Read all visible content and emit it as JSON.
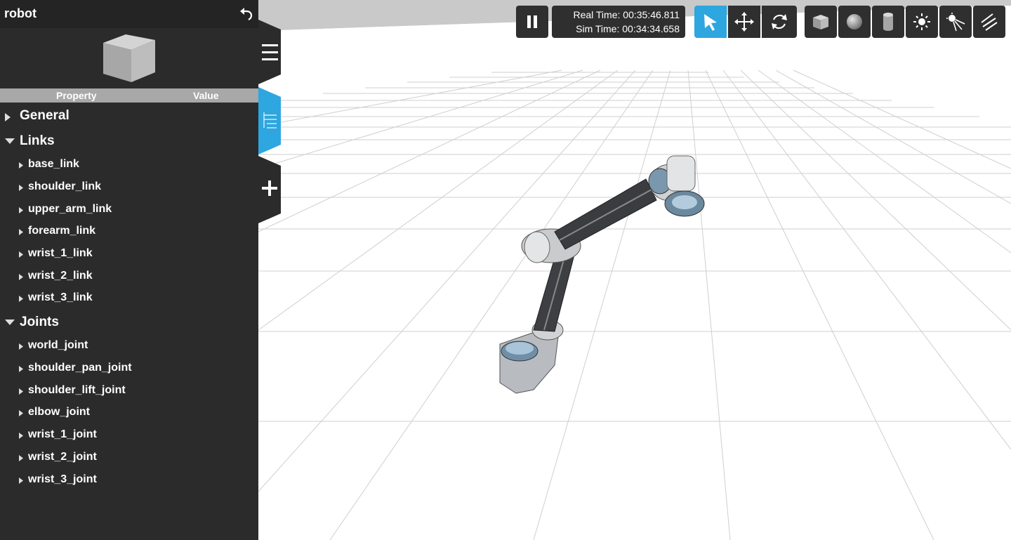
{
  "panel": {
    "title": "robot",
    "undo_icon": "undo-icon",
    "thumbnail_icon": "box-model-icon",
    "columns": {
      "property": "Property",
      "value": "Value"
    },
    "sections": {
      "general": {
        "label": "General",
        "expanded": false
      },
      "links": {
        "label": "Links",
        "expanded": true,
        "items": [
          "base_link",
          "shoulder_link",
          "upper_arm_link",
          "forearm_link",
          "wrist_1_link",
          "wrist_2_link",
          "wrist_3_link"
        ]
      },
      "joints": {
        "label": "Joints",
        "expanded": true,
        "items": [
          "world_joint",
          "shoulder_pan_joint",
          "shoulder_lift_joint",
          "elbow_joint",
          "wrist_1_joint",
          "wrist_2_joint",
          "wrist_3_joint"
        ]
      }
    }
  },
  "side_tabs": [
    {
      "icon": "hamburger-menu-icon",
      "active": false
    },
    {
      "icon": "tree-list-icon",
      "active": true
    },
    {
      "icon": "plus-icon",
      "active": false
    }
  ],
  "toolbar": {
    "pause_icon": "pause-icon",
    "real_time_label": "Real Time:",
    "real_time": "00:35:46.811",
    "sim_time_label": "Sim Time:",
    "sim_time": "00:34:34.658",
    "modes": [
      {
        "icon": "select-arrow-icon",
        "active": true
      },
      {
        "icon": "translate-icon",
        "active": false
      },
      {
        "icon": "rotate-icon",
        "active": false
      }
    ],
    "insert": [
      "box-icon",
      "sphere-icon",
      "cylinder-icon",
      "point-light-icon",
      "spot-light-icon",
      "directional-light-icon"
    ]
  },
  "colors": {
    "panel_bg": "#2b2b2b",
    "accent": "#2ea6df",
    "toolbar_bg": "#2f2f2f",
    "grid": "#c8c8c8"
  }
}
